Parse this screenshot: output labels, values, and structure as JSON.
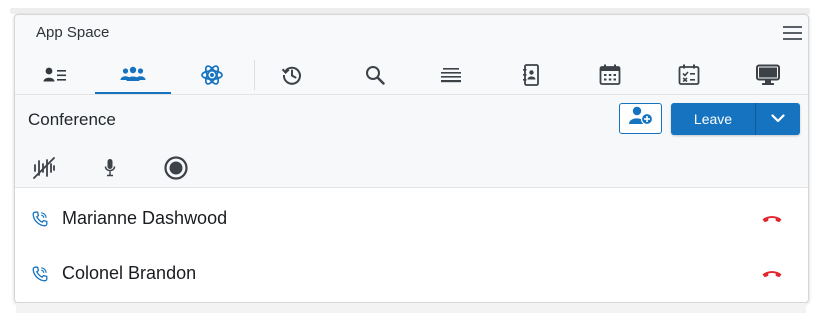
{
  "app": {
    "title": "App Space"
  },
  "tabs": [
    {
      "id": "contacts",
      "icon": "contact-card-icon",
      "active": false
    },
    {
      "id": "conference",
      "icon": "group-icon",
      "active": true
    },
    {
      "id": "ai",
      "icon": "atom-icon",
      "active": false
    },
    {
      "id": "history",
      "icon": "history-icon",
      "active": false
    },
    {
      "id": "search",
      "icon": "search-icon",
      "active": false
    },
    {
      "id": "queue",
      "icon": "stack-icon",
      "active": false
    },
    {
      "id": "address-book",
      "icon": "address-book-icon",
      "active": false
    },
    {
      "id": "calendar",
      "icon": "calendar-icon",
      "active": false
    },
    {
      "id": "tasks",
      "icon": "checklist-icon",
      "active": false
    },
    {
      "id": "screen",
      "icon": "monitor-icon",
      "active": false
    }
  ],
  "conference": {
    "title": "Conference",
    "leave_label": "Leave",
    "add_participant_icon": "add-person-icon",
    "controls": [
      {
        "id": "audio-off",
        "icon": "audio-waveform-muted-icon"
      },
      {
        "id": "mic",
        "icon": "microphone-icon"
      },
      {
        "id": "record",
        "icon": "record-icon"
      }
    ]
  },
  "participants": [
    {
      "name": "Marianne Dashwood",
      "icon": "phone-icon"
    },
    {
      "name": "Colonel Brandon",
      "icon": "phone-icon"
    }
  ],
  "colors": {
    "accent": "#1673c0",
    "hangup": "#e0262e",
    "icon": "#3c4248",
    "text": "#22272b"
  }
}
